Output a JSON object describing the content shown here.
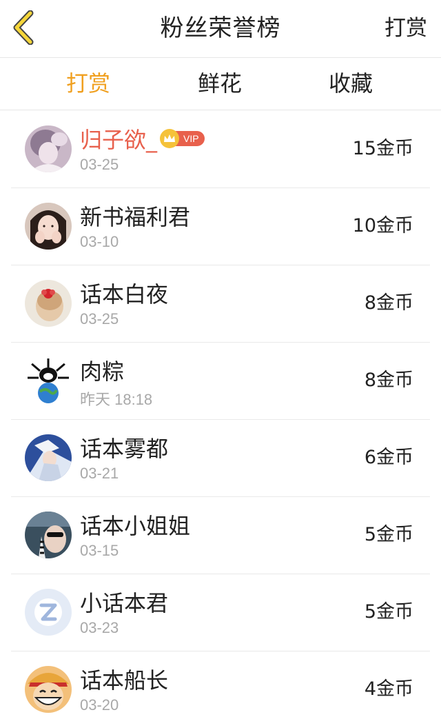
{
  "header": {
    "back_icon": "chevron-left-icon",
    "title": "粉丝荣誉榜",
    "action_label": "打赏",
    "accent_color": "#f0a020"
  },
  "tabs": [
    {
      "label": "打赏",
      "active": true
    },
    {
      "label": "鲜花",
      "active": false
    },
    {
      "label": "收藏",
      "active": false
    }
  ],
  "fans": [
    {
      "name": "归子欲_",
      "date": "03-25",
      "amount": "15金币",
      "vip": true,
      "vip_label": "VIP",
      "name_color": "#e8604c"
    },
    {
      "name": "新书福利君",
      "date": "03-10",
      "amount": "10金币",
      "vip": false
    },
    {
      "name": "话本白夜",
      "date": "03-25",
      "amount": "8金币",
      "vip": false
    },
    {
      "name": "肉粽",
      "date": "昨天 18:18",
      "amount": "8金币",
      "vip": false
    },
    {
      "name": "话本雾都",
      "date": "03-21",
      "amount": "6金币",
      "vip": false
    },
    {
      "name": "话本小姐姐",
      "date": "03-15",
      "amount": "5金币",
      "vip": false
    },
    {
      "name": "小话本君",
      "date": "03-23",
      "amount": "5金币",
      "vip": false
    },
    {
      "name": "话本船长",
      "date": "03-20",
      "amount": "4金币",
      "vip": false
    }
  ]
}
